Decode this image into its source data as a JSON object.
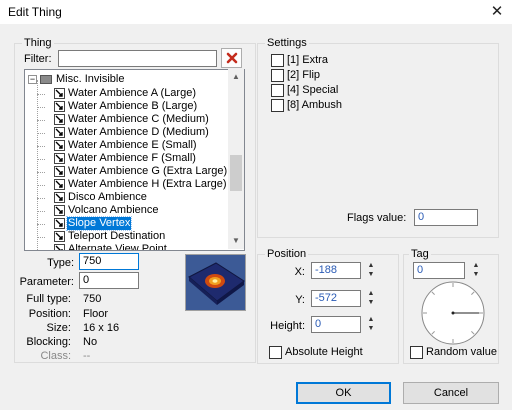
{
  "window": {
    "title": "Edit Thing",
    "close_glyph": "✕"
  },
  "thing": {
    "group_label": "Thing",
    "filter_label": "Filter:",
    "filter_value": "",
    "tree": {
      "category": "Misc. Invisible",
      "items": [
        {
          "label": "Water Ambience A (Large)"
        },
        {
          "label": "Water Ambience B (Large)"
        },
        {
          "label": "Water Ambience C (Medium)"
        },
        {
          "label": "Water Ambience D (Medium)"
        },
        {
          "label": "Water Ambience E (Small)"
        },
        {
          "label": "Water Ambience F (Small)"
        },
        {
          "label": "Water Ambience G (Extra Large)"
        },
        {
          "label": "Water Ambience H (Extra Large)"
        },
        {
          "label": "Disco Ambience"
        },
        {
          "label": "Volcano Ambience"
        },
        {
          "label": "Slope Vertex",
          "selected": true
        },
        {
          "label": "Teleport Destination"
        },
        {
          "label": "Alternate View Point"
        }
      ]
    },
    "type_label": "Type:",
    "type_value": "750",
    "parameter_label": "Parameter:",
    "parameter_value": "0",
    "info": [
      {
        "label": "Full type:",
        "value": "750"
      },
      {
        "label": "Position:",
        "value": "Floor"
      },
      {
        "label": "Size:",
        "value": "16 x 16"
      },
      {
        "label": "Blocking:",
        "value": "No"
      },
      {
        "label": "Class:",
        "value": "--",
        "disabled": true
      }
    ]
  },
  "settings": {
    "group_label": "Settings",
    "flags": [
      {
        "label": "[1] Extra",
        "checked": false
      },
      {
        "label": "[2] Flip",
        "checked": false
      },
      {
        "label": "[4] Special",
        "checked": false
      },
      {
        "label": "[8] Ambush",
        "checked": false
      }
    ],
    "flags_value_label": "Flags value:",
    "flags_value": "0"
  },
  "position": {
    "group_label": "Position",
    "x_label": "X:",
    "x_value": "-188",
    "y_label": "Y:",
    "y_value": "-572",
    "height_label": "Height:",
    "height_value": "0",
    "absolute_label": "Absolute Height"
  },
  "tag": {
    "group_label": "Tag",
    "value": "0",
    "angle_dial_icon": "angle-dial",
    "random_label": "Random value"
  },
  "buttons": {
    "ok": "OK",
    "cancel": "Cancel"
  },
  "colors": {
    "accent": "#0078d7",
    "value_text": "#2a5bb5",
    "clear_red": "#c42b1c"
  }
}
